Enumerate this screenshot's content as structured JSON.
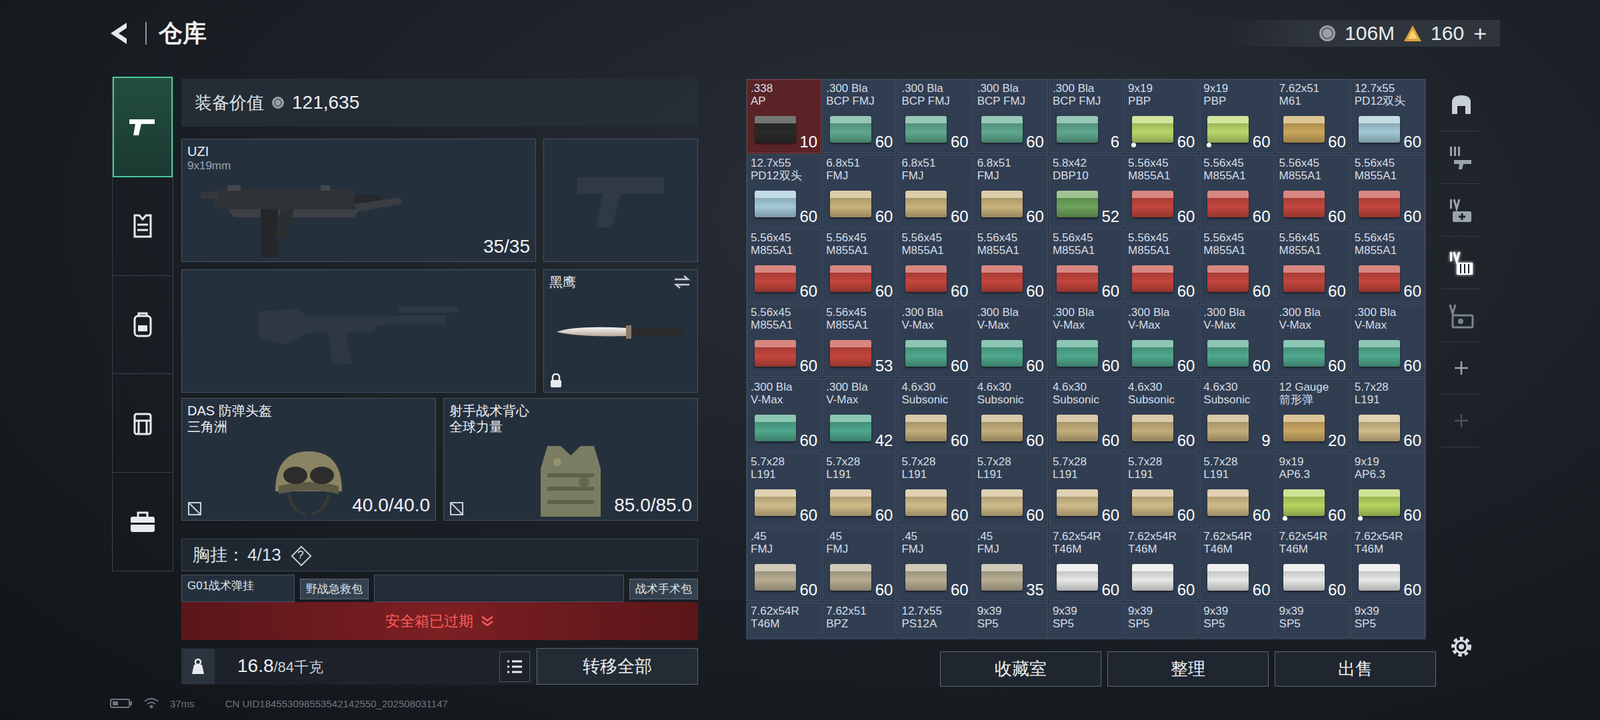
{
  "header": {
    "title": "仓库"
  },
  "currency": {
    "coins": "106M",
    "gems": "160",
    "plus": "+"
  },
  "nav": [
    {
      "kind": "weapon",
      "selected": true
    },
    {
      "kind": "vest",
      "selected": false
    },
    {
      "kind": "backpack",
      "selected": false
    },
    {
      "kind": "rig",
      "selected": false
    },
    {
      "kind": "case",
      "selected": false
    }
  ],
  "equipment": {
    "label": "装备价值",
    "value": "121,635",
    "primary": {
      "name": "UZI",
      "caliber": "9x19mm",
      "ammo": "35/35"
    },
    "knife": {
      "name": "黑鹰",
      "locked": true
    },
    "helmet": {
      "name": "DAS 防弹头盔",
      "brand": "三角洲",
      "durability": "40.0/40.0"
    },
    "vest": {
      "name": "射手战术背心",
      "brand": "全球力量",
      "durability": "85.0/85.0"
    },
    "rig": {
      "label": "胸挂：",
      "count": "4/13",
      "help": "?",
      "name": "G01战术弹挂",
      "items": [
        "野战急救包",
        "战术手术包"
      ]
    },
    "safe_box": "安全箱已过期",
    "weight": {
      "current": "16.8",
      "max": "/84千克"
    },
    "transfer": "转移全部"
  },
  "grid": {
    "rows": [
      [
        {
          "caliber": ".338",
          "type": "AP",
          "count": "10",
          "color": "#2b2b2b",
          "selected": true,
          "marked": false
        },
        {
          "caliber": ".300 Bla",
          "type": "BCP FMJ",
          "count": "60",
          "color": "#5fa98f",
          "selected": false,
          "marked": false
        },
        {
          "caliber": ".300 Bla",
          "type": "BCP FMJ",
          "count": "60",
          "color": "#5fa98f",
          "selected": false,
          "marked": false
        },
        {
          "caliber": ".300 Bla",
          "type": "BCP FMJ",
          "count": "60",
          "color": "#5fa98f",
          "selected": false,
          "marked": false
        },
        {
          "caliber": ".300 Bla",
          "type": "BCP FMJ",
          "count": "6",
          "color": "#5fa98f",
          "selected": false,
          "marked": false
        },
        {
          "caliber": "9x19",
          "type": "PBP",
          "count": "60",
          "color": "#b9d76a",
          "selected": false,
          "marked": true
        },
        {
          "caliber": "9x19",
          "type": "PBP",
          "count": "60",
          "color": "#b9d76a",
          "selected": false,
          "marked": true
        },
        {
          "caliber": "7.62x51",
          "type": "M61",
          "count": "60",
          "color": "#caa65c",
          "selected": false,
          "marked": false
        },
        {
          "caliber": "12.7x55",
          "type": "PD12双头",
          "count": "60",
          "color": "#a3c9d6",
          "selected": false,
          "marked": false
        }
      ],
      [
        {
          "caliber": "12.7x55",
          "type": "PD12双头",
          "count": "60",
          "color": "#a3c9d6",
          "selected": false,
          "marked": false
        },
        {
          "caliber": "6.8x51",
          "type": "FMJ",
          "count": "60",
          "color": "#c9b27c",
          "selected": false,
          "marked": false
        },
        {
          "caliber": "6.8x51",
          "type": "FMJ",
          "count": "60",
          "color": "#c9b27c",
          "selected": false,
          "marked": false
        },
        {
          "caliber": "6.8x51",
          "type": "FMJ",
          "count": "60",
          "color": "#c9b27c",
          "selected": false,
          "marked": false
        },
        {
          "caliber": "5.8x42",
          "type": "DBP10",
          "count": "52",
          "color": "#6da35b",
          "selected": false,
          "marked": false
        },
        {
          "caliber": "5.56x45",
          "type": "M855A1",
          "count": "60",
          "color": "#c4463d",
          "selected": false,
          "marked": false
        },
        {
          "caliber": "5.56x45",
          "type": "M855A1",
          "count": "60",
          "color": "#c4463d",
          "selected": false,
          "marked": false
        },
        {
          "caliber": "5.56x45",
          "type": "M855A1",
          "count": "60",
          "color": "#c4463d",
          "selected": false,
          "marked": false
        },
        {
          "caliber": "5.56x45",
          "type": "M855A1",
          "count": "60",
          "color": "#c4463d",
          "selected": false,
          "marked": false
        }
      ],
      [
        {
          "caliber": "5.56x45",
          "type": "M855A1",
          "count": "60",
          "color": "#c4463d",
          "selected": false,
          "marked": false
        },
        {
          "caliber": "5.56x45",
          "type": "M855A1",
          "count": "60",
          "color": "#c4463d",
          "selected": false,
          "marked": false
        },
        {
          "caliber": "5.56x45",
          "type": "M855A1",
          "count": "60",
          "color": "#c4463d",
          "selected": false,
          "marked": false
        },
        {
          "caliber": "5.56x45",
          "type": "M855A1",
          "count": "60",
          "color": "#c4463d",
          "selected": false,
          "marked": false
        },
        {
          "caliber": "5.56x45",
          "type": "M855A1",
          "count": "60",
          "color": "#c4463d",
          "selected": false,
          "marked": false
        },
        {
          "caliber": "5.56x45",
          "type": "M855A1",
          "count": "60",
          "color": "#c4463d",
          "selected": false,
          "marked": false
        },
        {
          "caliber": "5.56x45",
          "type": "M855A1",
          "count": "60",
          "color": "#c4463d",
          "selected": false,
          "marked": false
        },
        {
          "caliber": "5.56x45",
          "type": "M855A1",
          "count": "60",
          "color": "#c4463d",
          "selected": false,
          "marked": false
        },
        {
          "caliber": "5.56x45",
          "type": "M855A1",
          "count": "60",
          "color": "#c4463d",
          "selected": false,
          "marked": false
        }
      ],
      [
        {
          "caliber": "5.56x45",
          "type": "M855A1",
          "count": "60",
          "color": "#c4463d",
          "selected": false,
          "marked": false
        },
        {
          "caliber": "5.56x45",
          "type": "M855A1",
          "count": "53",
          "color": "#c4463d",
          "selected": false,
          "marked": false
        },
        {
          "caliber": ".300 Bla",
          "type": "V-Max",
          "count": "60",
          "color": "#4fa88d",
          "selected": false,
          "marked": false
        },
        {
          "caliber": ".300 Bla",
          "type": "V-Max",
          "count": "60",
          "color": "#4fa88d",
          "selected": false,
          "marked": false
        },
        {
          "caliber": ".300 Bla",
          "type": "V-Max",
          "count": "60",
          "color": "#4fa88d",
          "selected": false,
          "marked": false
        },
        {
          "caliber": ".300 Bla",
          "type": "V-Max",
          "count": "60",
          "color": "#4fa88d",
          "selected": false,
          "marked": false
        },
        {
          "caliber": ".300 Bla",
          "type": "V-Max",
          "count": "60",
          "color": "#4fa88d",
          "selected": false,
          "marked": false
        },
        {
          "caliber": ".300 Bla",
          "type": "V-Max",
          "count": "60",
          "color": "#4fa88d",
          "selected": false,
          "marked": false
        },
        {
          "caliber": ".300 Bla",
          "type": "V-Max",
          "count": "60",
          "color": "#4fa88d",
          "selected": false,
          "marked": false
        }
      ],
      [
        {
          "caliber": ".300 Bla",
          "type": "V-Max",
          "count": "60",
          "color": "#4fa88d",
          "selected": false,
          "marked": false
        },
        {
          "caliber": ".300 Bla",
          "type": "V-Max",
          "count": "42",
          "color": "#4fa88d",
          "selected": false,
          "marked": false
        },
        {
          "caliber": "4.6x30",
          "type": "Subsonic",
          "count": "60",
          "color": "#c3ae7b",
          "selected": false,
          "marked": false
        },
        {
          "caliber": "4.6x30",
          "type": "Subsonic",
          "count": "60",
          "color": "#c3ae7b",
          "selected": false,
          "marked": false
        },
        {
          "caliber": "4.6x30",
          "type": "Subsonic",
          "count": "60",
          "color": "#c3ae7b",
          "selected": false,
          "marked": false
        },
        {
          "caliber": "4.6x30",
          "type": "Subsonic",
          "count": "60",
          "color": "#c3ae7b",
          "selected": false,
          "marked": false
        },
        {
          "caliber": "4.6x30",
          "type": "Subsonic",
          "count": "9",
          "color": "#c3ae7b",
          "selected": false,
          "marked": false
        },
        {
          "caliber": "12 Gauge",
          "type": "箭形弹",
          "count": "20",
          "color": "#caa862",
          "selected": false,
          "marked": false
        },
        {
          "caliber": "5.7x28",
          "type": "L191",
          "count": "60",
          "color": "#cfba89",
          "selected": false,
          "marked": false
        }
      ],
      [
        {
          "caliber": "5.7x28",
          "type": "L191",
          "count": "60",
          "color": "#cfba89",
          "selected": false,
          "marked": false
        },
        {
          "caliber": "5.7x28",
          "type": "L191",
          "count": "60",
          "color": "#cfba89",
          "selected": false,
          "marked": false
        },
        {
          "caliber": "5.7x28",
          "type": "L191",
          "count": "60",
          "color": "#cfba89",
          "selected": false,
          "marked": false
        },
        {
          "caliber": "5.7x28",
          "type": "L191",
          "count": "60",
          "color": "#cfba89",
          "selected": false,
          "marked": false
        },
        {
          "caliber": "5.7x28",
          "type": "L191",
          "count": "60",
          "color": "#cfba89",
          "selected": false,
          "marked": false
        },
        {
          "caliber": "5.7x28",
          "type": "L191",
          "count": "60",
          "color": "#cfba89",
          "selected": false,
          "marked": false
        },
        {
          "caliber": "5.7x28",
          "type": "L191",
          "count": "60",
          "color": "#cfba89",
          "selected": false,
          "marked": false
        },
        {
          "caliber": "9x19",
          "type": "AP6.3",
          "count": "60",
          "color": "#b6d45f",
          "selected": false,
          "marked": true
        },
        {
          "caliber": "9x19",
          "type": "AP6.3",
          "count": "60",
          "color": "#b6d45f",
          "selected": false,
          "marked": true
        }
      ],
      [
        {
          "caliber": ".45",
          "type": "FMJ",
          "count": "60",
          "color": "#b7ad93",
          "selected": false,
          "marked": false
        },
        {
          "caliber": ".45",
          "type": "FMJ",
          "count": "60",
          "color": "#b7ad93",
          "selected": false,
          "marked": false
        },
        {
          "caliber": ".45",
          "type": "FMJ",
          "count": "60",
          "color": "#b7ad93",
          "selected": false,
          "marked": false
        },
        {
          "caliber": ".45",
          "type": "FMJ",
          "count": "35",
          "color": "#b7ad93",
          "selected": false,
          "marked": false
        },
        {
          "caliber": "7.62x54R",
          "type": "T46M",
          "count": "60",
          "color": "#e8e8e8",
          "selected": false,
          "marked": false
        },
        {
          "caliber": "7.62x54R",
          "type": "T46M",
          "count": "60",
          "color": "#e8e8e8",
          "selected": false,
          "marked": false
        },
        {
          "caliber": "7.62x54R",
          "type": "T46M",
          "count": "60",
          "color": "#e8e8e8",
          "selected": false,
          "marked": false
        },
        {
          "caliber": "7.62x54R",
          "type": "T46M",
          "count": "60",
          "color": "#e8e8e8",
          "selected": false,
          "marked": false
        },
        {
          "caliber": "7.62x54R",
          "type": "T46M",
          "count": "60",
          "color": "#e8e8e8",
          "selected": false,
          "marked": false
        }
      ]
    ],
    "partial_row": [
      {
        "caliber": "7.62x54R",
        "type": "T46M"
      },
      {
        "caliber": "7.62x51",
        "type": "BPZ"
      },
      {
        "caliber": "12.7x55",
        "type": "PS12A"
      },
      {
        "caliber": "9x39",
        "type": "SP5"
      },
      {
        "caliber": "9x39",
        "type": "SP5"
      },
      {
        "caliber": "9x39",
        "type": "SP5"
      },
      {
        "caliber": "9x39",
        "type": "SP5"
      },
      {
        "caliber": "9x39",
        "type": "SP5"
      },
      {
        "caliber": "9x39",
        "type": "SP5"
      }
    ]
  },
  "buttons": [
    "收藏室",
    "整理",
    "出售"
  ],
  "right_tabs": [
    {
      "kind": "safe",
      "selected": false
    },
    {
      "kind": "weapon-case",
      "selected": false
    },
    {
      "kind": "medical",
      "selected": false
    },
    {
      "kind": "rig-case",
      "selected": true
    },
    {
      "kind": "key-case",
      "selected": false
    },
    {
      "kind": "add",
      "selected": false
    },
    {
      "kind": "add-dim",
      "selected": false
    }
  ],
  "status": {
    "ping": "37ms",
    "uid": "CN UID184553098553542142550_202508031147"
  }
}
